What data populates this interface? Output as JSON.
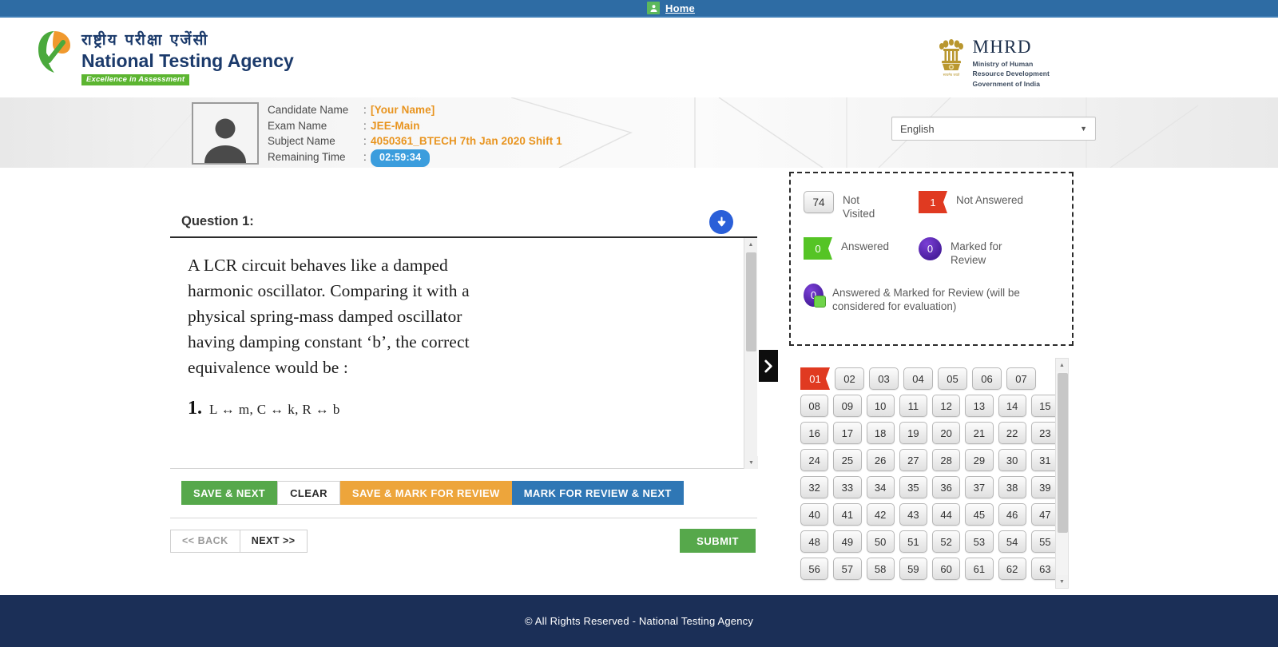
{
  "topbar": {
    "home_label": "Home",
    "home_icon": "user-icon",
    "bg": "#2e6ca4"
  },
  "brand": {
    "hindi": "राष्ट्रीय परीक्षा एजेंसी",
    "english": "National Testing Agency",
    "tagline": "Excellence in Assessment",
    "logo_icon": "nta-leaf-logo"
  },
  "ministry": {
    "emblem_icon": "india-emblem-icon",
    "title": "MHRD",
    "line1": "Ministry of Human",
    "line2": "Resource Development",
    "line3": "Government of India"
  },
  "candidate": {
    "avatar_icon": "user-avatar-icon",
    "rows": [
      {
        "label": "Candidate Name",
        "value": "[Your Name]"
      },
      {
        "label": "Exam Name",
        "value": "JEE-Main"
      },
      {
        "label": "Subject Name",
        "value": "4050361_BTECH 7th Jan 2020 Shift 1"
      }
    ],
    "time_label": "Remaining Time",
    "time_value": "02:59:34"
  },
  "language": {
    "selected": "English",
    "caret_icon": "chevron-down-icon"
  },
  "question": {
    "title": "Question 1:",
    "download_icon": "download-circle-icon",
    "text": "A LCR circuit behaves like a damped harmonic oscillator. Comparing it with a physical spring-mass damped oscillator having damping constant ‘b’, the correct equivalence would be :",
    "options": [
      {
        "num": "1.",
        "text": "L ↔ m, C ↔ k, R ↔ b"
      }
    ]
  },
  "actions": {
    "save_next": "SAVE & NEXT",
    "clear": "CLEAR",
    "save_mark": "SAVE & MARK FOR REVIEW",
    "mark_next": "MARK FOR REVIEW & NEXT",
    "back": "<< BACK",
    "next": "NEXT >>",
    "submit": "SUBMIT"
  },
  "collapse": {
    "icon": "chevron-right-icon"
  },
  "legend": {
    "items": [
      {
        "count": "74",
        "label": "Not Visited",
        "style": "not-visited"
      },
      {
        "count": "1",
        "label": "Not Answered",
        "style": "not-answered"
      },
      {
        "count": "0",
        "label": "Answered",
        "style": "answered"
      },
      {
        "count": "0",
        "label": "Marked for Review",
        "style": "marked"
      },
      {
        "count": "0",
        "label": "Answered & Marked for Review (will be considered for evaluation)",
        "style": "answered-marked"
      }
    ]
  },
  "palette": {
    "rows": [
      [
        {
          "n": "01",
          "state": "not-answered"
        },
        {
          "n": "02",
          "state": "not-visited"
        },
        {
          "n": "03",
          "state": "not-visited"
        },
        {
          "n": "04",
          "state": "not-visited"
        },
        {
          "n": "05",
          "state": "not-visited"
        },
        {
          "n": "06",
          "state": "not-visited"
        },
        {
          "n": "07",
          "state": "not-visited"
        }
      ],
      [
        {
          "n": "08",
          "state": "not-visited"
        },
        {
          "n": "09",
          "state": "not-visited"
        },
        {
          "n": "10",
          "state": "not-visited"
        },
        {
          "n": "11",
          "state": "not-visited"
        },
        {
          "n": "12",
          "state": "not-visited"
        },
        {
          "n": "13",
          "state": "not-visited"
        },
        {
          "n": "14",
          "state": "not-visited"
        },
        {
          "n": "15",
          "state": "not-visited"
        }
      ],
      [
        {
          "n": "16",
          "state": "not-visited"
        },
        {
          "n": "17",
          "state": "not-visited"
        },
        {
          "n": "18",
          "state": "not-visited"
        },
        {
          "n": "19",
          "state": "not-visited"
        },
        {
          "n": "20",
          "state": "not-visited"
        },
        {
          "n": "21",
          "state": "not-visited"
        },
        {
          "n": "22",
          "state": "not-visited"
        },
        {
          "n": "23",
          "state": "not-visited"
        }
      ],
      [
        {
          "n": "24",
          "state": "not-visited"
        },
        {
          "n": "25",
          "state": "not-visited"
        },
        {
          "n": "26",
          "state": "not-visited"
        },
        {
          "n": "27",
          "state": "not-visited"
        },
        {
          "n": "28",
          "state": "not-visited"
        },
        {
          "n": "29",
          "state": "not-visited"
        },
        {
          "n": "30",
          "state": "not-visited"
        },
        {
          "n": "31",
          "state": "not-visited"
        }
      ],
      [
        {
          "n": "32",
          "state": "not-visited"
        },
        {
          "n": "33",
          "state": "not-visited"
        },
        {
          "n": "34",
          "state": "not-visited"
        },
        {
          "n": "35",
          "state": "not-visited"
        },
        {
          "n": "36",
          "state": "not-visited"
        },
        {
          "n": "37",
          "state": "not-visited"
        },
        {
          "n": "38",
          "state": "not-visited"
        },
        {
          "n": "39",
          "state": "not-visited"
        }
      ],
      [
        {
          "n": "40",
          "state": "not-visited"
        },
        {
          "n": "41",
          "state": "not-visited"
        },
        {
          "n": "42",
          "state": "not-visited"
        },
        {
          "n": "43",
          "state": "not-visited"
        },
        {
          "n": "44",
          "state": "not-visited"
        },
        {
          "n": "45",
          "state": "not-visited"
        },
        {
          "n": "46",
          "state": "not-visited"
        },
        {
          "n": "47",
          "state": "not-visited"
        }
      ],
      [
        {
          "n": "48",
          "state": "not-visited"
        },
        {
          "n": "49",
          "state": "not-visited"
        },
        {
          "n": "50",
          "state": "not-visited"
        },
        {
          "n": "51",
          "state": "not-visited"
        },
        {
          "n": "52",
          "state": "not-visited"
        },
        {
          "n": "53",
          "state": "not-visited"
        },
        {
          "n": "54",
          "state": "not-visited"
        },
        {
          "n": "55",
          "state": "not-visited"
        }
      ],
      [
        {
          "n": "56",
          "state": "not-visited"
        },
        {
          "n": "57",
          "state": "not-visited"
        },
        {
          "n": "58",
          "state": "not-visited"
        },
        {
          "n": "59",
          "state": "not-visited"
        },
        {
          "n": "60",
          "state": "not-visited"
        },
        {
          "n": "61",
          "state": "not-visited"
        },
        {
          "n": "62",
          "state": "not-visited"
        },
        {
          "n": "63",
          "state": "not-visited"
        }
      ]
    ]
  },
  "footer": {
    "text": "© All Rights Reserved - National Testing Agency",
    "bg": "#1b2f57"
  },
  "colors": {
    "topbar": "#2e6ca4",
    "accent_orange": "#e8941f",
    "green": "#56a84b",
    "red": "#e03a21",
    "purple": "#4a1f9e",
    "blue": "#2f77b5"
  }
}
